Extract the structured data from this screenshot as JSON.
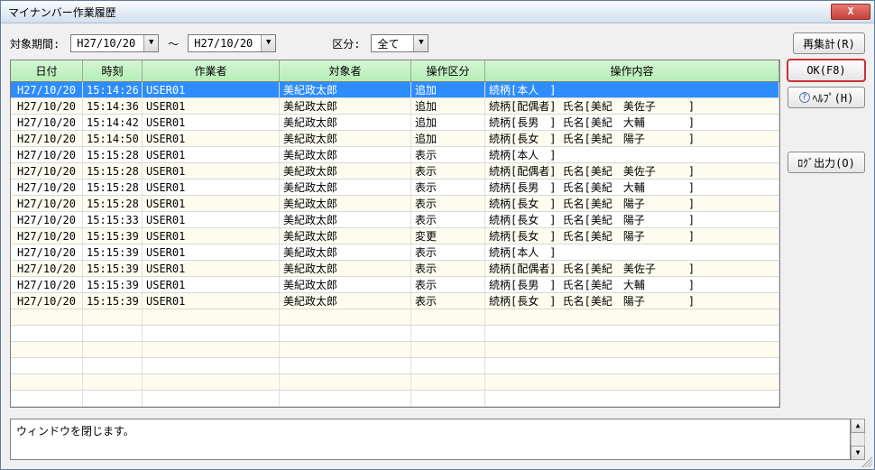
{
  "window": {
    "title": "マイナンバー作業履歴"
  },
  "filters": {
    "period_label": "対象期間:",
    "date_from": "H27/10/20",
    "tilde": "～",
    "date_to": "H27/10/20",
    "kubun_label": "区分:",
    "kubun_value": "全て"
  },
  "buttons": {
    "recalc": "再集計(R)",
    "ok": "OK(F8)",
    "help": "ﾍﾙﾌﾟ(H)",
    "log_out": "ﾛｸﾞ出力(O)",
    "close_x": "X"
  },
  "grid": {
    "headers": {
      "date": "日付",
      "time": "時刻",
      "user": "作業者",
      "target": "対象者",
      "op": "操作区分",
      "detail": "操作内容"
    },
    "rows": [
      {
        "date": "H27/10/20",
        "time": "15:14:26",
        "user": "USER01",
        "target": "美紀政太郎",
        "op": "追加",
        "detail": "続柄[本人　]",
        "selected": true
      },
      {
        "date": "H27/10/20",
        "time": "15:14:36",
        "user": "USER01",
        "target": "美紀政太郎",
        "op": "追加",
        "detail": "続柄[配偶者] 氏名[美紀　美佐子　　　]"
      },
      {
        "date": "H27/10/20",
        "time": "15:14:42",
        "user": "USER01",
        "target": "美紀政太郎",
        "op": "追加",
        "detail": "続柄[長男　] 氏名[美紀　大輔　　　　]"
      },
      {
        "date": "H27/10/20",
        "time": "15:14:50",
        "user": "USER01",
        "target": "美紀政太郎",
        "op": "追加",
        "detail": "続柄[長女　] 氏名[美紀　陽子　　　　]"
      },
      {
        "date": "H27/10/20",
        "time": "15:15:28",
        "user": "USER01",
        "target": "美紀政太郎",
        "op": "表示",
        "detail": "続柄[本人　]"
      },
      {
        "date": "H27/10/20",
        "time": "15:15:28",
        "user": "USER01",
        "target": "美紀政太郎",
        "op": "表示",
        "detail": "続柄[配偶者] 氏名[美紀　美佐子　　　]"
      },
      {
        "date": "H27/10/20",
        "time": "15:15:28",
        "user": "USER01",
        "target": "美紀政太郎",
        "op": "表示",
        "detail": "続柄[長男　] 氏名[美紀　大輔　　　　]"
      },
      {
        "date": "H27/10/20",
        "time": "15:15:28",
        "user": "USER01",
        "target": "美紀政太郎",
        "op": "表示",
        "detail": "続柄[長女　] 氏名[美紀　陽子　　　　]"
      },
      {
        "date": "H27/10/20",
        "time": "15:15:33",
        "user": "USER01",
        "target": "美紀政太郎",
        "op": "表示",
        "detail": "続柄[長女　] 氏名[美紀　陽子　　　　]"
      },
      {
        "date": "H27/10/20",
        "time": "15:15:39",
        "user": "USER01",
        "target": "美紀政太郎",
        "op": "変更",
        "detail": "続柄[長女　] 氏名[美紀　陽子　　　　]"
      },
      {
        "date": "H27/10/20",
        "time": "15:15:39",
        "user": "USER01",
        "target": "美紀政太郎",
        "op": "表示",
        "detail": "続柄[本人　]"
      },
      {
        "date": "H27/10/20",
        "time": "15:15:39",
        "user": "USER01",
        "target": "美紀政太郎",
        "op": "表示",
        "detail": "続柄[配偶者] 氏名[美紀　美佐子　　　]"
      },
      {
        "date": "H27/10/20",
        "time": "15:15:39",
        "user": "USER01",
        "target": "美紀政太郎",
        "op": "表示",
        "detail": "続柄[長男　] 氏名[美紀　大輔　　　　]"
      },
      {
        "date": "H27/10/20",
        "time": "15:15:39",
        "user": "USER01",
        "target": "美紀政太郎",
        "op": "表示",
        "detail": "続柄[長女　] 氏名[美紀　陽子　　　　]"
      }
    ],
    "empty_rows": 6
  },
  "status": {
    "text": "ウィンドウを閉じます。"
  }
}
